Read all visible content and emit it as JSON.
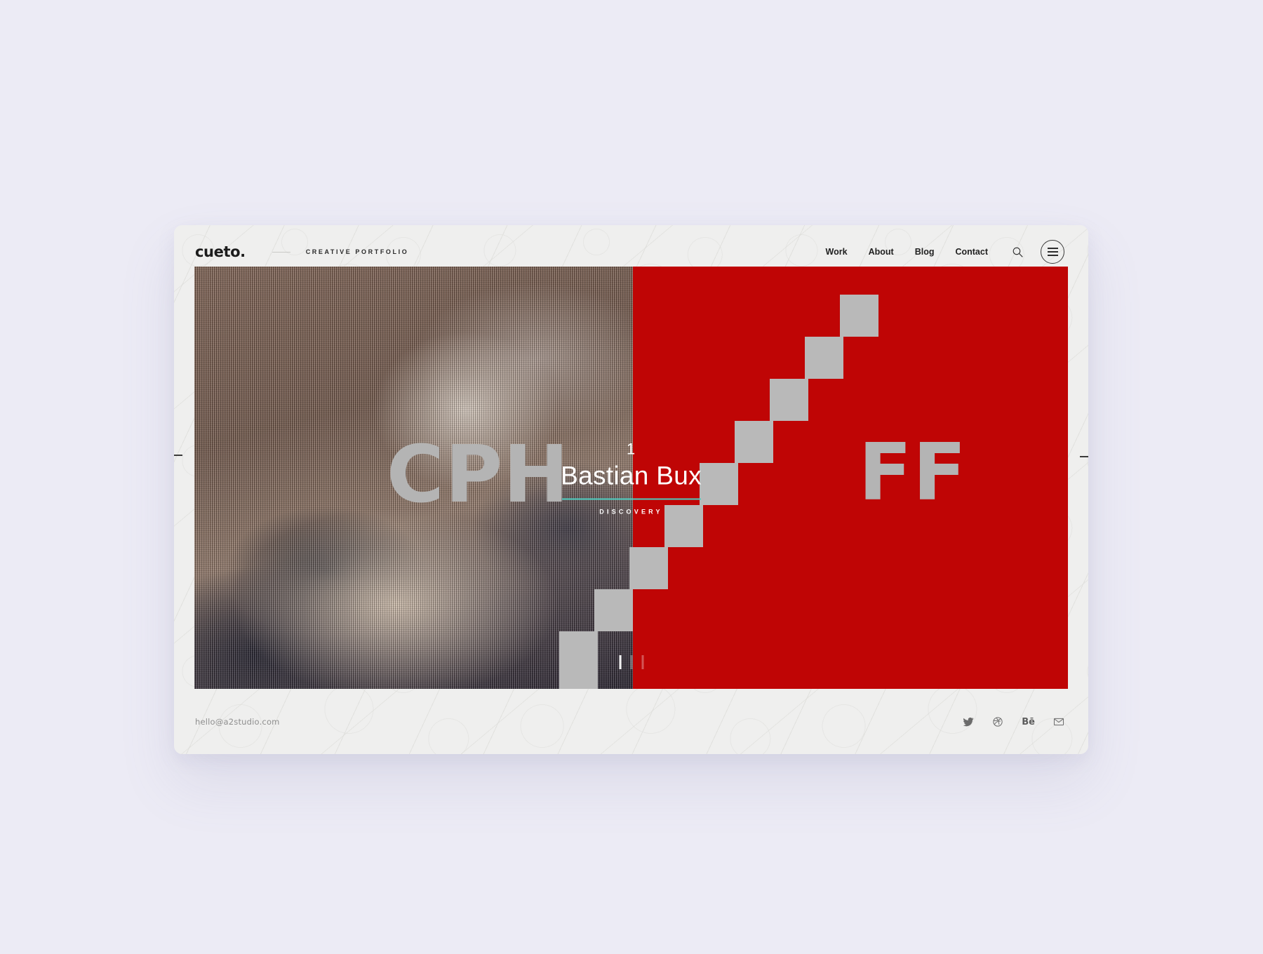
{
  "header": {
    "logo": "cueto.",
    "tagline": "CREATIVE PORTFOLIO",
    "nav": [
      {
        "label": "Work"
      },
      {
        "label": "About"
      },
      {
        "label": "Blog"
      },
      {
        "label": "Contact"
      }
    ],
    "search_icon": "search-icon",
    "menu_icon": "hamburger-menu-icon"
  },
  "hero": {
    "left_word": "CPH",
    "right_word": "FF",
    "slide_number": "1",
    "title": "Bastian Bux",
    "subtitle": "DISCOVERY",
    "accent_color": "#4ecdc0",
    "panel_red": "#bf0505",
    "word_color": "#b4b4b4",
    "stair_color": "#b9b9b9",
    "slides": [
      {
        "active": true
      },
      {
        "active": false
      },
      {
        "active": false
      }
    ]
  },
  "controls": {
    "prev_key": "P",
    "next_key": "N"
  },
  "footer": {
    "email": "hello@a2studio.com",
    "social": [
      {
        "name": "twitter-icon",
        "label": "Twitter"
      },
      {
        "name": "dribbble-icon",
        "label": "Dribbble"
      },
      {
        "name": "behance-icon",
        "label": "Bē"
      },
      {
        "name": "email-icon",
        "label": "Email"
      }
    ]
  }
}
